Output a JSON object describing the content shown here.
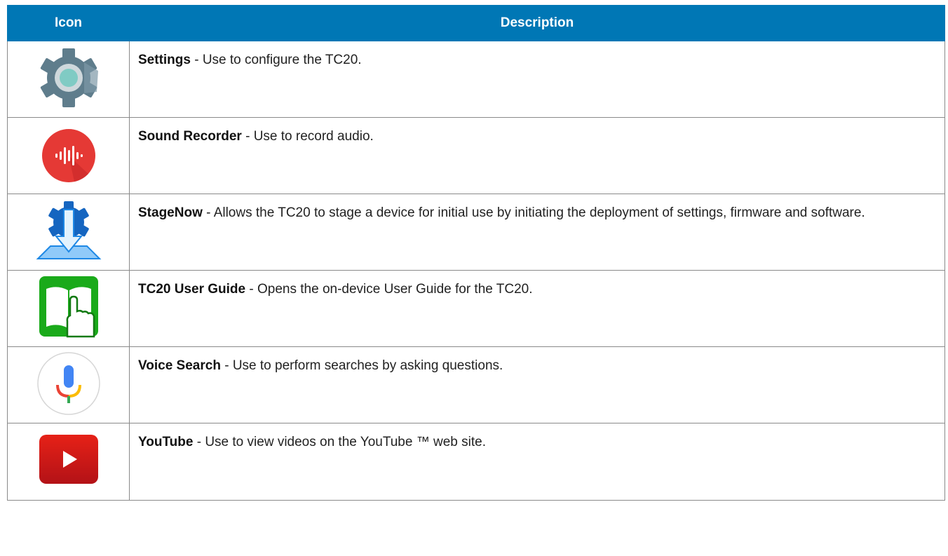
{
  "table": {
    "headers": {
      "icon": "Icon",
      "description": "Description"
    },
    "rows": [
      {
        "icon": "settings-gear-icon",
        "name": "Settings",
        "text": " - Use to configure the TC20."
      },
      {
        "icon": "sound-recorder-icon",
        "name": "Sound Recorder",
        "text": " - Use to record audio."
      },
      {
        "icon": "stagenow-icon",
        "name": "StageNow",
        "text": " - Allows the TC20 to stage a device for initial use by initiating the deployment of settings, firmware and software."
      },
      {
        "icon": "user-guide-book-icon",
        "name": "TC20 User Guide",
        "text": " - Opens the on-device User Guide for the TC20."
      },
      {
        "icon": "microphone-icon",
        "name": "Voice Search",
        "text": " - Use to perform searches by asking questions."
      },
      {
        "icon": "youtube-play-icon",
        "name": "YouTube",
        "text": " - Use to view videos on the YouTube ™ web site."
      }
    ]
  },
  "colors": {
    "header_bg": "#0077b5",
    "header_text": "#ffffff",
    "border": "#8a8a8a"
  }
}
